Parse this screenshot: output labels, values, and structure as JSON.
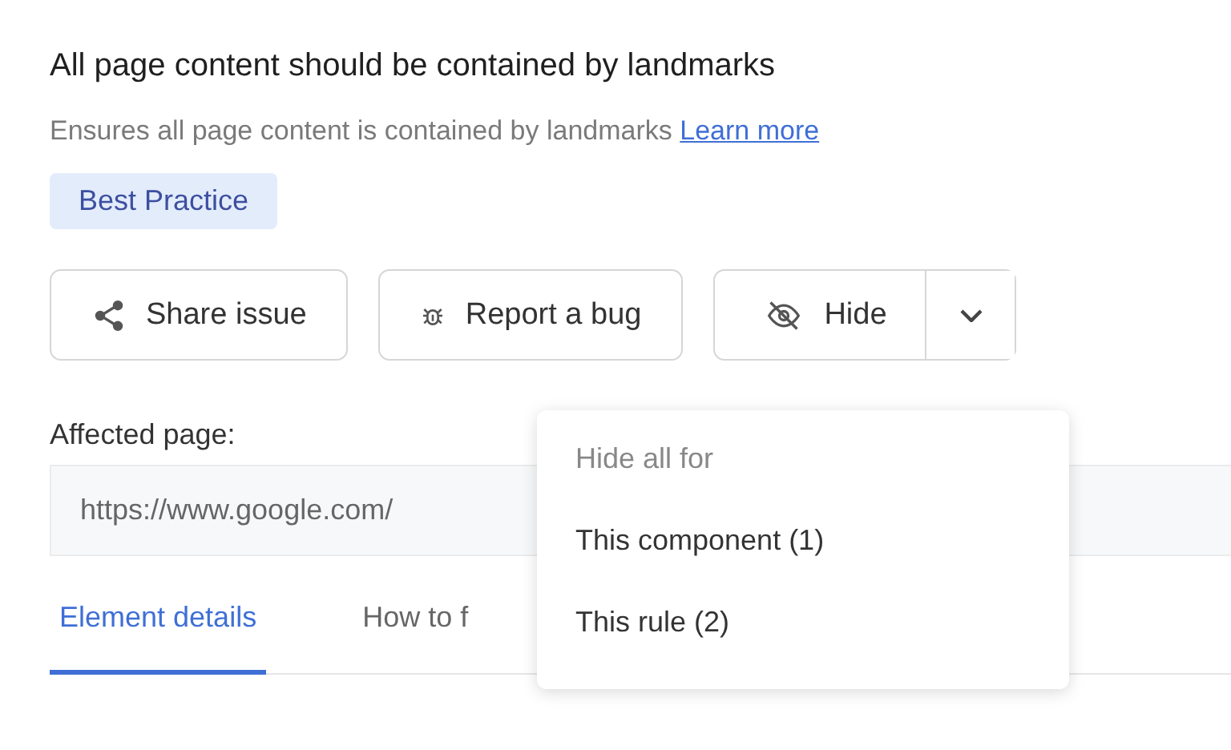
{
  "title": "All page content should be contained by landmarks",
  "description": "Ensures all page content is contained by landmarks",
  "learn_more": "Learn more",
  "tag": "Best Practice",
  "actions": [
    {
      "kind": "share",
      "label": "Share issue"
    },
    {
      "kind": "bug",
      "label": "Report a bug"
    }
  ],
  "hide": {
    "label": "Hide",
    "expanded": true
  },
  "menu": {
    "heading": "Hide all for",
    "items": [
      "This component (1)",
      "This rule (2)"
    ]
  },
  "affected_page": {
    "label": "Affected page:",
    "value": "https://www.google.com/"
  },
  "tabs": [
    {
      "label": "Element details",
      "selected": true
    },
    {
      "label": "How to f",
      "selected": false
    }
  ]
}
